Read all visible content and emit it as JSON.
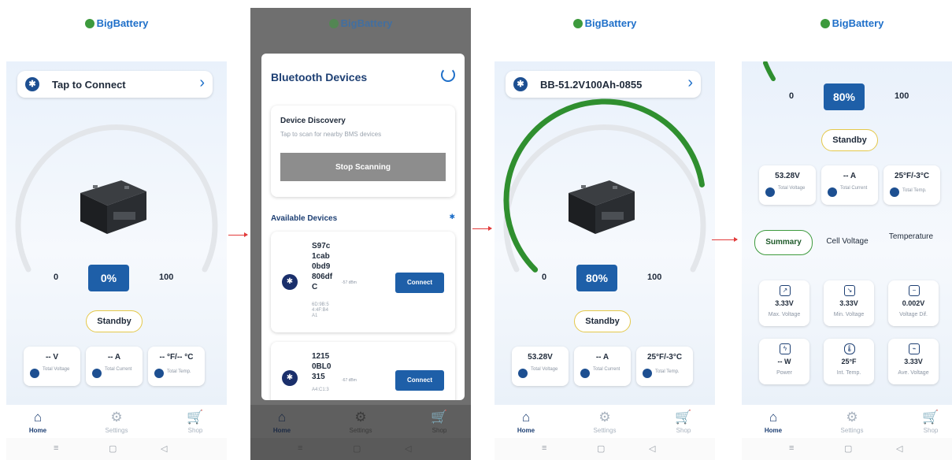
{
  "brand": "BigBattery",
  "colors": {
    "primary": "#1e5fa8",
    "accent_green": "#2f8f2f",
    "standby_border": "#e4c84a"
  },
  "nav": {
    "home": "Home",
    "settings": "Settings",
    "shop": "Shop"
  },
  "screen1": {
    "connect_label": "Tap to Connect",
    "gauge_min": "0",
    "gauge_max": "100",
    "percent": "0%",
    "status": "Standby",
    "stats": [
      {
        "value": "-- V",
        "label": "Total Voltage"
      },
      {
        "value": "-- A",
        "label": "Total Current"
      },
      {
        "value": "-- °F/-- °C",
        "label": "Total Temp."
      }
    ]
  },
  "screen2": {
    "modal_title": "Bluetooth Devices",
    "discovery_title": "Device Discovery",
    "discovery_subtitle": "Tap to scan for nearby BMS devices",
    "stop_button": "Stop Scanning",
    "available_title": "Available Devices",
    "devices": [
      {
        "name": "S97c 1cab 0bd9 806df C",
        "signal": "-57 dBm",
        "mac": "6D:9B:5 4:4F:B4 A1",
        "connect": "Connect"
      },
      {
        "name": "1215 0BL0 315",
        "signal": "-67 dBm",
        "mac": "A4:C1:3",
        "connect": "Connect"
      }
    ]
  },
  "screen3": {
    "connect_label": "BB-51.2V100Ah-0855",
    "gauge_min": "0",
    "gauge_max": "100",
    "percent": "80%",
    "gauge_fill": 0.8,
    "status": "Standby",
    "stats": [
      {
        "value": "53.28V",
        "label": "Total Voltage"
      },
      {
        "value": "-- A",
        "label": "Total Current"
      },
      {
        "value": "25°F/-3°C",
        "label": "Total Temp."
      }
    ]
  },
  "screen4": {
    "gauge_min": "0",
    "gauge_max": "100",
    "percent": "80%",
    "status": "Standby",
    "stats": [
      {
        "value": "53.28V",
        "label": "Total Voltage"
      },
      {
        "value": "-- A",
        "label": "Total Current"
      },
      {
        "value": "25°F/-3°C",
        "label": "Total Temp."
      }
    ],
    "tabs": [
      "Summary",
      "Cell Voltage",
      "Temperature"
    ],
    "metrics": [
      {
        "value": "3.33V",
        "label": "Max. Voltage",
        "icon": "chart-up-icon"
      },
      {
        "value": "3.33V",
        "label": "Min. Voltage",
        "icon": "chart-down-icon"
      },
      {
        "value": "0.002V",
        "label": "Voltage Dif.",
        "icon": "minus-box-icon"
      },
      {
        "value": "-- W",
        "label": "Power",
        "icon": "lightning-icon"
      },
      {
        "value": "25°F",
        "label": "Int. Temp.",
        "icon": "thermometer-icon"
      },
      {
        "value": "3.33V",
        "label": "Ave. Voltage",
        "icon": "chart-avg-icon"
      }
    ]
  }
}
